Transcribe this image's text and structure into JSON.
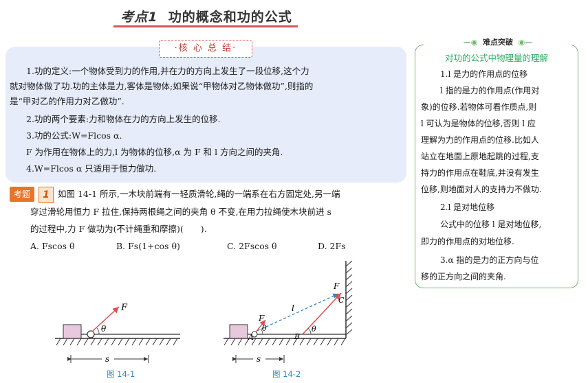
{
  "header": {
    "title_prefix": "考点",
    "title_num": "1",
    "title_text": "功的概念和功的公式",
    "badge": "·核 心 总 结·"
  },
  "summary": {
    "lines": [
      "1.功的定义:一个物体受到力的作用,并在力的方向上发生了一段位移,这个力",
      "就对物体做了功.功的主体是力,客体是物体;如果说“甲物体对乙物体做功”,则指的",
      "是“甲对乙的作用力对乙做功”.",
      "2.功的两个要素:力和物体在力的方向上发生的位移.",
      "3.功的公式:W=Flcos α.",
      "F 为作用在物体上的力,l 为物体的位移,α 为 F 和 l 方向之间的夹角.",
      "4.W=Flcos α 只适用于恒力做功."
    ]
  },
  "example": {
    "tag": "考题",
    "num": "1",
    "lines": [
      "如图 14-1 所示,一木块前端有一轻质滑轮,绳的一端系在右方固定处,另一端",
      "穿过滑轮用恒力 F 拉住,保持两根绳之间的夹角 θ 不变,在用力拉绳使木块前进 s",
      "的过程中,力 F 做功为(不计绳重和摩擦)(　　)."
    ],
    "options": [
      "A. Fscos θ",
      "B. Fs(1+cos θ)",
      "C. 2Fscos θ",
      "D. 2Fs"
    ]
  },
  "figures": {
    "fig1": {
      "caption": "图 14-1",
      "F": "F",
      "theta": "θ",
      "s": "s"
    },
    "fig2": {
      "caption": "图 14-2",
      "F1": "F",
      "F2": "F",
      "l": "l",
      "A": "A",
      "B": "B",
      "C": "C",
      "theta1": "θ",
      "theta2": "θ",
      "s": "s"
    }
  },
  "sidebar": {
    "head": "难点突破",
    "title": "对功的公式中物理量的理解",
    "lines": [
      "1.l 是力的作用点的位移",
      "l 指的是力的作用点(作用对",
      "象)的位移.若物体可看作质点,则",
      "l 可认为是物体的位移,否则 l 应",
      "理解为力的作用点的位移.比如人",
      "站立在地面上原地起跳的过程,支",
      "持力的作用点在鞋底,并没有发生",
      "位移,则地面对人的支持力不做功.",
      "2.l 是对地位移",
      "公式中的位移 l 是对地位移,",
      "即力的作用点的对地位移.",
      "3.α 指的是力的正方向与位",
      "移的正方向之间的夹角."
    ]
  },
  "colors": {
    "accent_red": "#d9534f",
    "orange": "#e8742a",
    "green": "#6dbb6d",
    "blue_panel": "#e6ecfa",
    "caption_blue": "#2e86c1"
  }
}
